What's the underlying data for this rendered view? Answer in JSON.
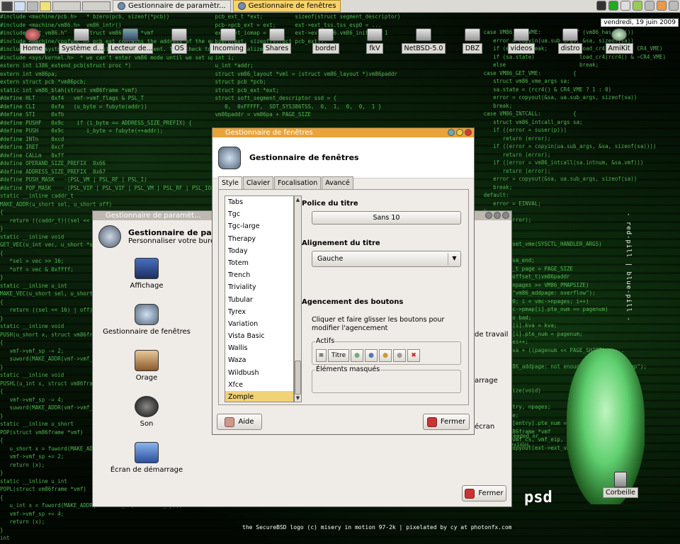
{
  "taskbar": {
    "tasks": [
      {
        "label": "Gestionnaire de paramètr...",
        "active": false
      },
      {
        "label": "Gestionnaire de fenêtres",
        "active": true
      }
    ],
    "clock": "vendredi, 19 juin 2009"
  },
  "desktop": {
    "icons": [
      "Home",
      "Système d...",
      "Lecteur de...",
      "OS",
      "Incoming",
      "Shares",
      "bordel",
      "fkV",
      "NetBSD-5.0",
      "DBZ",
      "videos",
      "distro",
      "AmiKit"
    ],
    "trash": "Corbeille",
    "credit": "the SecureBSD logo (c) misery in motion 97-2k | pixelated by cy at photonfx.com",
    "vertical_text": "- red-pill | blue-pill -",
    "brand_tail": "psd"
  },
  "settings_window": {
    "title": "Gestionnaire de paramèt...",
    "header_title": "Gestionnaire de pa",
    "header_subtitle": "Personnaliser votre burea",
    "items": [
      "Affichage",
      "Gestionnaire de fenêtres",
      "Orage",
      "Son",
      "Écran de démarrage"
    ],
    "right_fragments": [
      "de travail",
      "arrage",
      "écran"
    ],
    "close_button": "Fermer"
  },
  "wm_window": {
    "title": "Gestionnaire de fenêtres",
    "header_title": "Gestionnaire de fenêtres",
    "tabs": [
      "Style",
      "Clavier",
      "Focalisation",
      "Avancé"
    ],
    "selected_tab": "Style",
    "themes": [
      "Tabs",
      "Tgc",
      "Tgc-large",
      "Therapy",
      "Today",
      "Totem",
      "Trench",
      "Triviality",
      "Tubular",
      "Tyrex",
      "Variation",
      "Vista Basic",
      "Wallis",
      "Waza",
      "Wildbush",
      "Xfce",
      "Zomple"
    ],
    "selected_theme": "Zomple",
    "title_font_label": "Police du titre",
    "title_font_value": "Sans 10",
    "title_align_label": "Alignement du titre",
    "title_align_value": "Gauche",
    "buttons_layout_label": "Agencement des boutons",
    "buttons_layout_desc": "Cliquer et faire glisser les boutons pour modifier l'agencement",
    "active_label": "Actifs",
    "active_buttons": [
      "≡",
      "Titre",
      "●",
      "●",
      "●",
      "●",
      "✖"
    ],
    "hidden_label": "Éléments masqués",
    "help_button": "Aide",
    "close_button": "Fermer"
  },
  "colors": {
    "accent": "#e8a33a",
    "selection": "#f0d277",
    "matrix_green": "#5fcf5f"
  }
}
